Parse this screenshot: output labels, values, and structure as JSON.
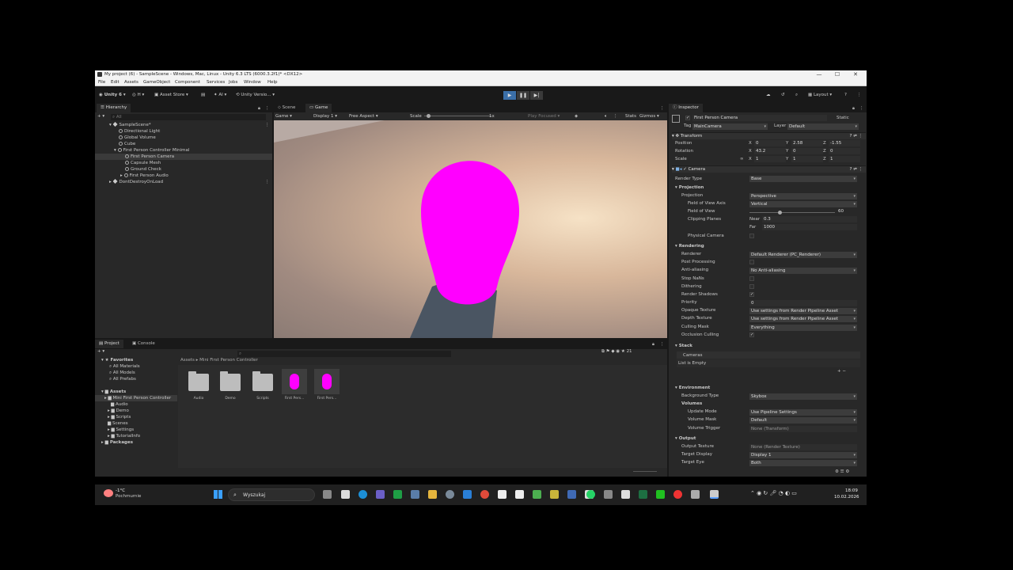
{
  "window": {
    "title": "My project (6) - SampleScene - Windows, Mac, Linux - Unity 6.3 LTS (6000.3.2f1)* <DX12>",
    "controls": {
      "minimize": "—",
      "maximize": "☐",
      "close": "✕"
    }
  },
  "menu": [
    "File",
    "Edit",
    "Assets",
    "GameObject",
    "Component",
    "Services",
    "Jobs",
    "Window",
    "Help"
  ],
  "toolbar": {
    "account": "Unity 6",
    "account_initial": "H",
    "asset_store": "Asset Store",
    "ai": "AI",
    "version_control": "Unity Versio...",
    "layout": "Layout"
  },
  "hierarchy": {
    "tab": "Hierarchy",
    "search_placeholder": "All",
    "scene": "SampleScene*",
    "items": [
      {
        "label": "Directional Light"
      },
      {
        "label": "Global Volume"
      },
      {
        "label": "Cube"
      },
      {
        "label": "First Person Controller Minimal"
      },
      {
        "label": "First Person Camera"
      },
      {
        "label": "Capsule Mesh"
      },
      {
        "label": "Ground Check"
      },
      {
        "label": "First Person Audio"
      }
    ],
    "dontdestroy": "DontDestroyOnLoad"
  },
  "game_view": {
    "tabs": [
      "Scene",
      "Game"
    ],
    "display_mode": "Game",
    "display": "Display 1",
    "aspect": "Free Aspect",
    "scale_label": "Scale",
    "scale_value": "1x",
    "play_focused": "Play Focused",
    "stats": "Stats",
    "gizmos": "Gizmos"
  },
  "project": {
    "tabs": [
      "Project",
      "Console"
    ],
    "favorites_label": "Favorites",
    "favorites": [
      "All Materials",
      "All Models",
      "All Prefabs"
    ],
    "assets_label": "Assets",
    "tree": [
      "Mini First Person Controller",
      "Audio",
      "Demo",
      "Scripts",
      "Scenes",
      "Settings",
      "TutorialInfo"
    ],
    "packages": "Packages",
    "breadcrumb": [
      "Assets",
      "Mini First Person Controller"
    ],
    "asset_items": [
      {
        "name": "Audio",
        "kind": "folder"
      },
      {
        "name": "Demo",
        "kind": "folder"
      },
      {
        "name": "Scripts",
        "kind": "folder"
      },
      {
        "name": "First Pers...",
        "kind": "prefab"
      },
      {
        "name": "First Pers...",
        "kind": "prefab"
      }
    ],
    "count": "21"
  },
  "inspector": {
    "tab": "Inspector",
    "object_name": "First Person Camera",
    "static": "Static",
    "tag_label": "Tag",
    "tag": "MainCamera",
    "layer_label": "Layer",
    "layer": "Default",
    "transform": {
      "title": "Transform",
      "position_label": "Position",
      "position": [
        "0",
        "2.58",
        "-1.55"
      ],
      "rotation_label": "Rotation",
      "rotation": [
        "43.2",
        "0",
        "0"
      ],
      "scale_label": "Scale",
      "scale": [
        "1",
        "1",
        "1"
      ]
    },
    "camera": {
      "title": "Camera",
      "render_type_label": "Render Type",
      "render_type": "Base",
      "projection_section": "Projection",
      "projection_label": "Projection",
      "projection": "Perspective",
      "fov_axis_label": "Field of View Axis",
      "fov_axis": "Vertical",
      "fov_label": "Field of View",
      "fov": "60",
      "fov_fraction": 0.35,
      "clipping_label": "Clipping Planes",
      "near_label": "Near",
      "near": "0.3",
      "far_label": "Far",
      "far": "1000",
      "physical_label": "Physical Camera",
      "rendering_section": "Rendering",
      "renderer_label": "Renderer",
      "renderer": "Default Renderer (PC_Renderer)",
      "post_label": "Post Processing",
      "aa_label": "Anti-aliasing",
      "aa": "No Anti-aliasing",
      "stopnan_label": "Stop NaNs",
      "dither_label": "Dithering",
      "shadows_label": "Render Shadows",
      "priority_label": "Priority",
      "priority": "0",
      "opaque_label": "Opaque Texture",
      "opaque": "Use settings from Render Pipeline Asset",
      "depth_label": "Depth Texture",
      "depth": "Use settings from Render Pipeline Asset",
      "culling_label": "Culling Mask",
      "culling": "Everything",
      "occlusion_label": "Occlusion Culling",
      "stack_section": "Stack",
      "cameras_label": "Cameras",
      "empty_list": "List is Empty",
      "env_section": "Environment",
      "bg_label": "Background Type",
      "bg": "Skybox",
      "volumes_label": "Volumes",
      "update_label": "Update Mode",
      "update": "Use Pipeline Settings",
      "vmask_label": "Volume Mask",
      "vmask": "Default",
      "vtrigger_label": "Volume Trigger",
      "vtrigger": "None (Transform)",
      "output_section": "Output",
      "otex_label": "Output Texture",
      "otex": "None (Render Texture)",
      "tdisp_label": "Target Display",
      "tdisp": "Display 1",
      "teye_label": "Target Eye",
      "teye": "Both"
    }
  },
  "taskbar": {
    "weather_temp": "-1°C",
    "weather_desc": "Pochmurnie",
    "search": "Wyszukaj",
    "time": "18:09",
    "date": "10.02.2026"
  },
  "colors": {
    "capsule": "#ff00ff",
    "play_active": "#3b6fa8"
  }
}
